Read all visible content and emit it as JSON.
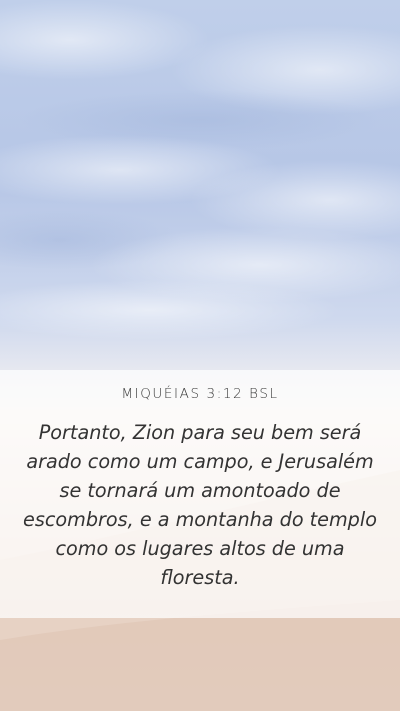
{
  "reference": "MIQUÉIAS 3:12 BSL",
  "verse": "Portanto, Zion para seu bem será arado como um campo, e Jerusalém se tornará um amontoado de escombros, e a montanha do templo como os lugares altos de uma floresta.",
  "colors": {
    "sky_top": "#b8c8e6",
    "sky_mid": "#d6dff0",
    "horizon": "#f2ece8",
    "sand": "#e8d2c4",
    "sand_dark": "#d9bfae",
    "text": "#333333"
  }
}
